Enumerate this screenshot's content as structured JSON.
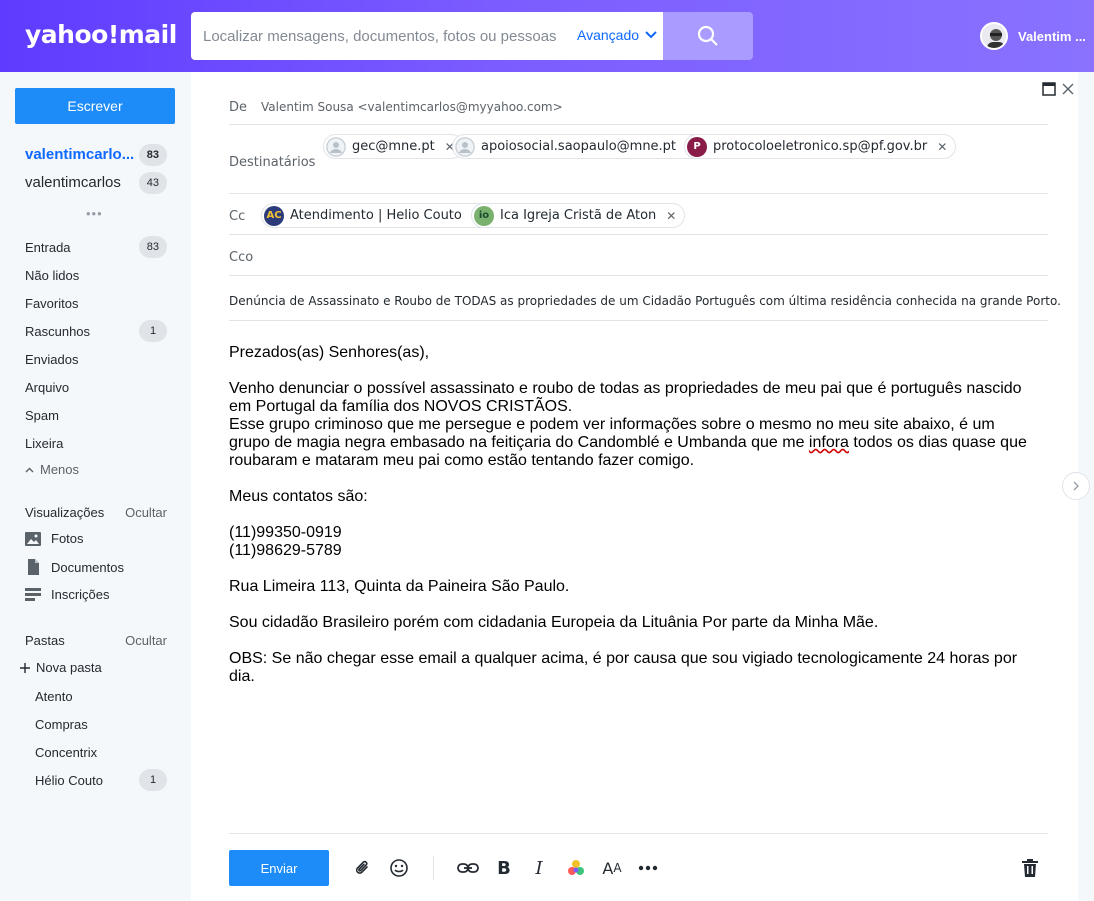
{
  "header": {
    "logo": "yahoo!mail",
    "search_placeholder": "Localizar mensagens, documentos, fotos ou pessoas",
    "advanced_label": "Avançado",
    "user_name": "Valentim ..."
  },
  "sidebar": {
    "compose_label": "Escrever",
    "accounts": [
      {
        "name": "valentimcarlo...",
        "count": "83"
      },
      {
        "name": "valentimcarlos",
        "count": "43"
      }
    ],
    "more_dots": "•••",
    "folders": [
      {
        "label": "Entrada",
        "count": "83"
      },
      {
        "label": "Não lidos",
        "count": ""
      },
      {
        "label": "Favoritos",
        "count": ""
      },
      {
        "label": "Rascunhos",
        "count": "1"
      },
      {
        "label": "Enviados",
        "count": ""
      },
      {
        "label": "Arquivo",
        "count": ""
      },
      {
        "label": "Spam",
        "count": ""
      },
      {
        "label": "Lixeira",
        "count": ""
      }
    ],
    "less_label": "Menos",
    "views_title": "Visualizações",
    "views_hide": "Ocultar",
    "views": [
      {
        "label": "Fotos",
        "icon": "photo-icon"
      },
      {
        "label": "Documentos",
        "icon": "document-icon"
      },
      {
        "label": "Inscrições",
        "icon": "subscriptions-icon"
      }
    ],
    "folders_title": "Pastas",
    "folders_hide": "Ocultar",
    "new_folder": "Nova pasta",
    "user_folders": [
      {
        "label": "Atento",
        "count": ""
      },
      {
        "label": "Compras",
        "count": ""
      },
      {
        "label": "Concentrix",
        "count": ""
      },
      {
        "label": "Hélio Couto",
        "count": "1"
      }
    ]
  },
  "compose": {
    "from_label": "De",
    "from_value": "Valentim Sousa <valentimcarlos@myyahoo.com>",
    "to_label": "Destinatários",
    "to": [
      {
        "email": "gec@mne.pt",
        "avatar": ""
      },
      {
        "email": "apoiosocial.saopaulo@mne.pt",
        "avatar": ""
      },
      {
        "email": "protocoloeletronico.sp@pf.gov.br",
        "avatar": "P"
      }
    ],
    "cc_label": "Cc",
    "cc": [
      {
        "name": "Atendimento | Helio Couto",
        "avatar": "AC"
      },
      {
        "name": "Ica Igreja Cristã de Aton",
        "avatar": "io"
      }
    ],
    "bcc_label": "Cco",
    "subject": "Denúncia de Assassinato e Roubo de TODAS as propriedades de um Cidadão Português com última residência conhecida na grande Porto.",
    "body": {
      "greeting": "Prezados(as) Senhores(as),",
      "p1_line1": "Venho denunciar o possível assassinato e roubo de todas as propriedades de meu pai que é português nascido",
      "p1_line2": "em Portugal da família dos NOVOS CRISTÃOS.",
      "p1_line3": "Esse grupo criminoso que me persegue e podem ver informações sobre o mesmo no meu site abaixo, é um",
      "p1_line4a": "grupo de magia negra embasado na feitiçaria do Candomblé e Umbanda que me ",
      "p1_line4_misspelled": "infora",
      "p1_line4b": " todos os dias quase que",
      "p1_line5": "roubaram e mataram meu pai como estão tentando fazer comigo.",
      "contacts_title": "Meus contatos são:",
      "phone1": "(11)99350-0919",
      "phone2": "(11)98629-5789",
      "address": "Rua Limeira 113, Quinta da Paineira São Paulo.",
      "citizenship": "Sou cidadão Brasileiro porém com cidadania Europeia da Lituânia Por parte da Minha Mãe.",
      "obs_line1": "OBS: Se não chegar esse email a qualquer acima, é por causa que sou vigiado tecnologicamente 24 horas por",
      "obs_line2": "dia."
    },
    "send_label": "Enviar"
  },
  "colors": {
    "header_gradient_start": "#5f3bff",
    "accent_blue": "#1d8cf8",
    "link_blue": "#0f69ff"
  }
}
